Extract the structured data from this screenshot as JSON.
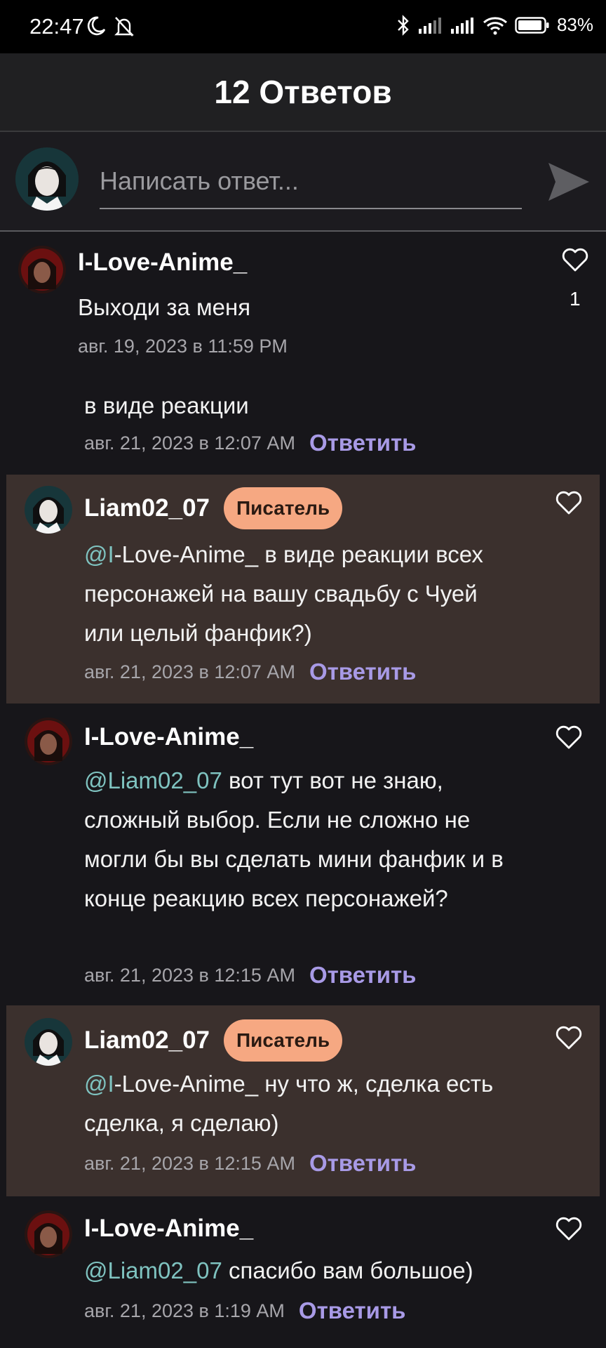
{
  "status_bar": {
    "time": "22:47",
    "battery": "83%"
  },
  "header": {
    "title": "12 Ответов"
  },
  "compose": {
    "placeholder": "Написать ответ..."
  },
  "reply_label": "Ответить",
  "comments": [
    {
      "author": "I-Love-Anime_",
      "text": "Выходи за меня",
      "date": "авг. 19, 2023 в 11:59 PM",
      "likes": "1"
    },
    {
      "text": "в виде реакции",
      "date": "авг. 21, 2023 в 12:07 AM"
    },
    {
      "author": "Liam02_07",
      "badge": "Писатель",
      "mention": "@I",
      "text": "-Love-Anime_ в виде реакции всех персонажей на вашу свадьбу с Чуей или целый фанфик?)",
      "date": "авг. 21, 2023 в 12:07 AM"
    },
    {
      "author": "I-Love-Anime_",
      "mention": "@Liam02_07",
      "text": " вот тут вот не знаю, сложный выбор. Если не сложно не могли бы вы сделать мини фанфик и в конце реакцию всех персонажей?",
      "date": "авг. 21, 2023 в 12:15 AM"
    },
    {
      "author": "Liam02_07",
      "badge": "Писатель",
      "mention": "@I",
      "text": "-Love-Anime_ ну что ж, сделка есть сделка, я сделаю)",
      "date": "авг. 21, 2023 в 12:15 AM"
    },
    {
      "author": "I-Love-Anime_",
      "mention": "@Liam02_07",
      "text": " спасибо вам большое)",
      "date": "авг. 21, 2023 в 1:19 AM"
    }
  ],
  "colors": {
    "writer_bg": "#3b302d",
    "badge": "#f6a882",
    "reply": "#a89ae6",
    "mention": "#7fc3c0"
  }
}
